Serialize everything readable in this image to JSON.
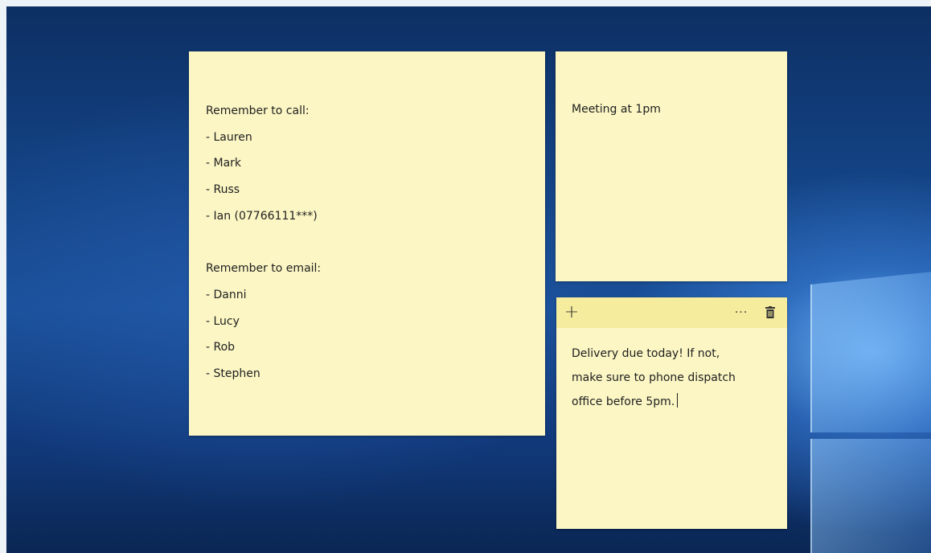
{
  "notes": {
    "calls_email": {
      "lines": [
        "Remember to call:",
        "- Lauren",
        "- Mark",
        "- Russ",
        "- Ian (07766111***)",
        "",
        "Remember to email:",
        "- Danni",
        "- Lucy",
        "- Rob",
        "- Stephen"
      ]
    },
    "meeting": {
      "text": "Meeting at 1pm"
    },
    "delivery": {
      "toolbar": {
        "new_note_icon": "+",
        "menu_icon": "···",
        "delete_icon": "trash-icon"
      },
      "lines": [
        "Delivery due today! If not,",
        "make sure to phone dispatch",
        "office before 5pm."
      ]
    }
  },
  "colors": {
    "note_background": "#fbf6c4",
    "note_toolbar": "#f5ec9e",
    "desktop_dark": "#0d2f63",
    "desktop_light": "#78beff"
  }
}
